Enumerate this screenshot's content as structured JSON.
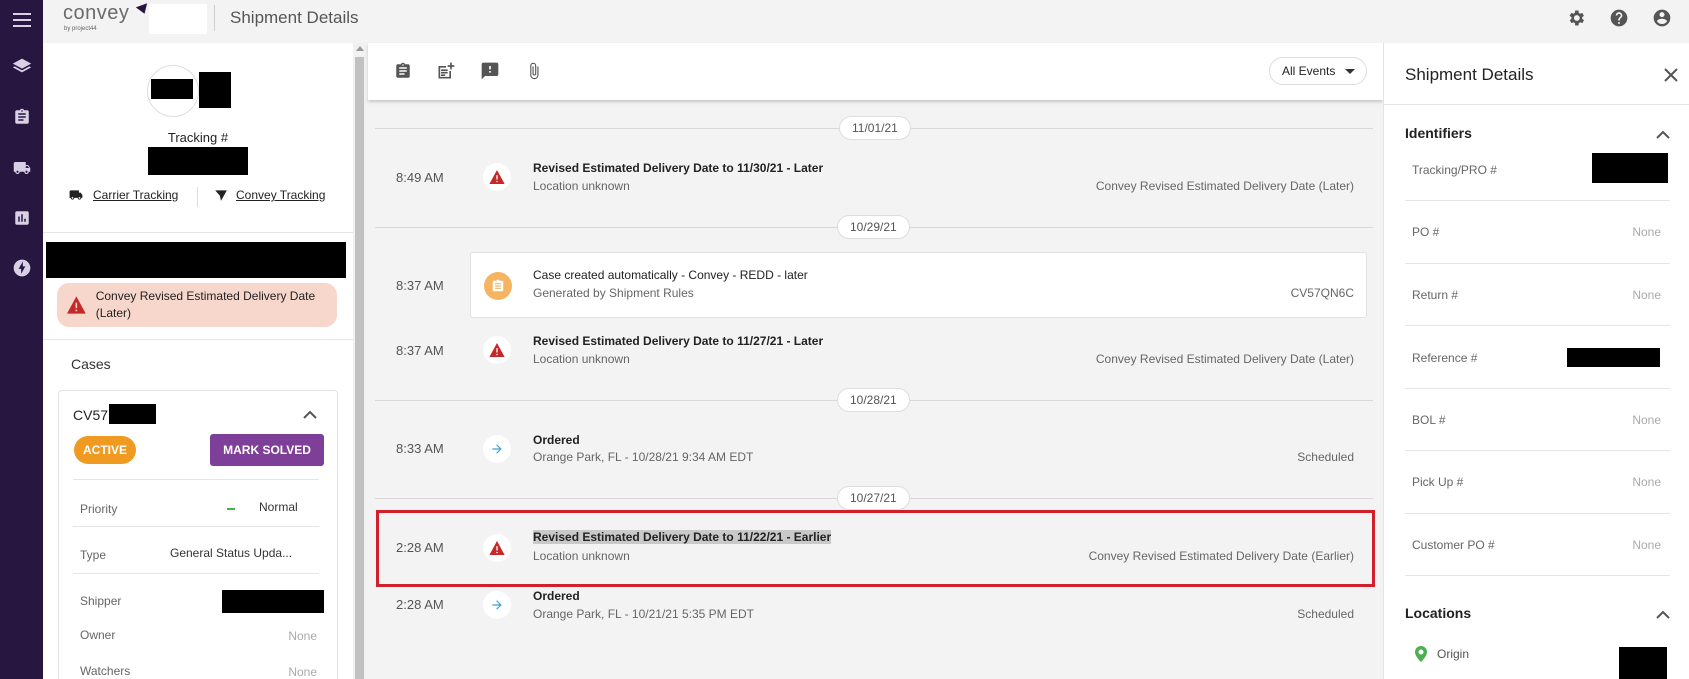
{
  "app": {
    "brand": "convey",
    "brand_sub": "by project44",
    "page_title": "Shipment Details"
  },
  "left_panel": {
    "tracking_label": "Tracking #",
    "carrier_tracking": "Carrier Tracking",
    "convey_tracking": "Convey Tracking",
    "alert_text": "Convey Revised Estimated Delivery Date (Later)",
    "cases_title": "Cases",
    "case": {
      "id_prefix": "CV57",
      "status": "ACTIVE",
      "mark_solved": "MARK SOLVED",
      "priority_label": "Priority",
      "priority_value": "Normal",
      "type_label": "Type",
      "type_value": "General Status Upda...",
      "shipper_label": "Shipper",
      "owner_label": "Owner",
      "owner_value": "None",
      "watchers_label": "Watchers",
      "watchers_value": "None"
    }
  },
  "center": {
    "filter": "All Events",
    "dates": [
      "11/01/21",
      "10/29/21",
      "10/28/21",
      "10/27/21"
    ],
    "events": [
      {
        "time": "8:49 AM",
        "title": "Revised Estimated Delivery Date to 11/30/21 - Later",
        "sub": "Location unknown",
        "right": "Convey Revised Estimated Delivery Date (Later)"
      },
      {
        "time": "8:37 AM",
        "title": "Case created automatically - Convey - REDD - later",
        "sub": "Generated by Shipment Rules",
        "right": "CV57QN6C"
      },
      {
        "time": "8:37 AM",
        "title": "Revised Estimated Delivery Date to 11/27/21 - Later",
        "sub": "Location unknown",
        "right": "Convey Revised Estimated Delivery Date (Later)"
      },
      {
        "time": "8:33 AM",
        "title": "Ordered",
        "sub": "Orange Park, FL - 10/28/21 9:34 AM EDT",
        "right": "Scheduled"
      },
      {
        "time": "2:28 AM",
        "title": "Revised Estimated Delivery Date to 11/22/21 - Earlier",
        "sub": "Location unknown",
        "right": "Convey Revised Estimated Delivery Date (Earlier)"
      },
      {
        "time": "2:28 AM",
        "title": "Ordered",
        "sub": "Orange Park, FL - 10/21/21 5:35 PM EDT",
        "right": "Scheduled"
      }
    ]
  },
  "right_panel": {
    "title": "Shipment Details",
    "identifiers_title": "Identifiers",
    "fields": [
      {
        "label": "Tracking/PRO #",
        "value": ""
      },
      {
        "label": "PO #",
        "value": "None"
      },
      {
        "label": "Return #",
        "value": "None"
      },
      {
        "label": "Reference #",
        "value": ""
      },
      {
        "label": "BOL #",
        "value": "None"
      },
      {
        "label": "Pick Up #",
        "value": "None"
      },
      {
        "label": "Customer PO #",
        "value": "None"
      }
    ],
    "locations_title": "Locations",
    "origin_label": "Origin"
  },
  "colors": {
    "rail": "#27163f",
    "active_badge": "#f19a22",
    "mark_solved": "#7e3f98",
    "alert_bg": "#f7d6cc",
    "warning_red": "#d0202c",
    "origin_green": "#4caf50"
  },
  "icons": {
    "rail": [
      "menu-icon",
      "layers-icon",
      "clipboard-icon",
      "truck-icon",
      "chart-icon",
      "bolt-icon"
    ],
    "top": [
      "gear-icon",
      "help-icon",
      "account-icon"
    ],
    "toolbar": [
      "clipboard-icon",
      "add-note-icon",
      "exception-icon",
      "attachment-icon"
    ]
  }
}
